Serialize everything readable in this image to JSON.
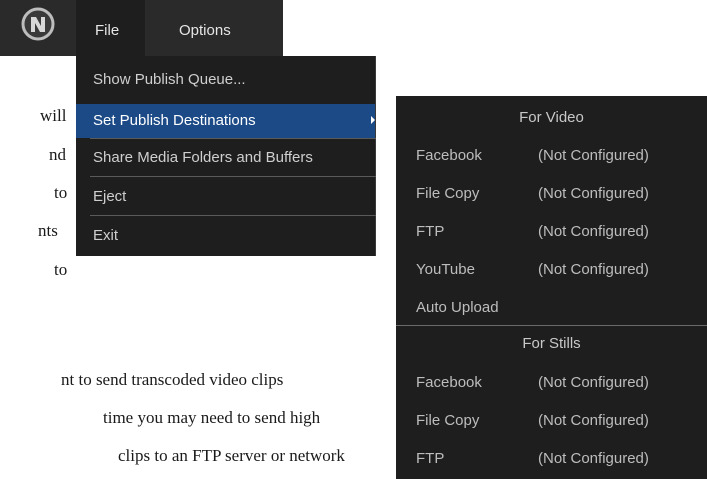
{
  "app": {
    "logo_icon": "app-logo-icon"
  },
  "menubar": {
    "file": "File",
    "options": "Options"
  },
  "file_menu": {
    "items": [
      {
        "label": "Show Publish Queue..."
      },
      {
        "label": "Set Publish Destinations",
        "has_submenu": true,
        "selected": true
      },
      {
        "label": "Share Media Folders and Buffers"
      },
      {
        "label": "Eject"
      },
      {
        "label": "Exit"
      }
    ]
  },
  "destinations_submenu": {
    "video_header": "For Video",
    "video": [
      {
        "name": "Facebook",
        "status": "(Not Configured)"
      },
      {
        "name": "File Copy",
        "status": "(Not Configured)"
      },
      {
        "name": "FTP",
        "status": "(Not Configured)"
      },
      {
        "name": "YouTube",
        "status": "(Not Configured)"
      }
    ],
    "auto_upload": "Auto Upload",
    "stills_header": "For Stills",
    "stills": [
      {
        "name": "Facebook",
        "status": "(Not Configured)"
      },
      {
        "name": "File Copy",
        "status": "(Not Configured)"
      },
      {
        "name": "FTP",
        "status": "(Not Configured)"
      }
    ]
  },
  "document": {
    "line_fragments": [
      "will",
      "nd",
      "to",
      "nts",
      "to"
    ],
    "paragraph_fragments": [
      "nt to send transcoded video clips",
      "time you may need to send high",
      "clips to an FTP server or network"
    ]
  },
  "colors": {
    "menubar_bg": "#2a2a2a",
    "menu_bg": "#1e1e1e",
    "selected_bg": "#1b4a86",
    "menu_text": "#cfcfcf"
  }
}
